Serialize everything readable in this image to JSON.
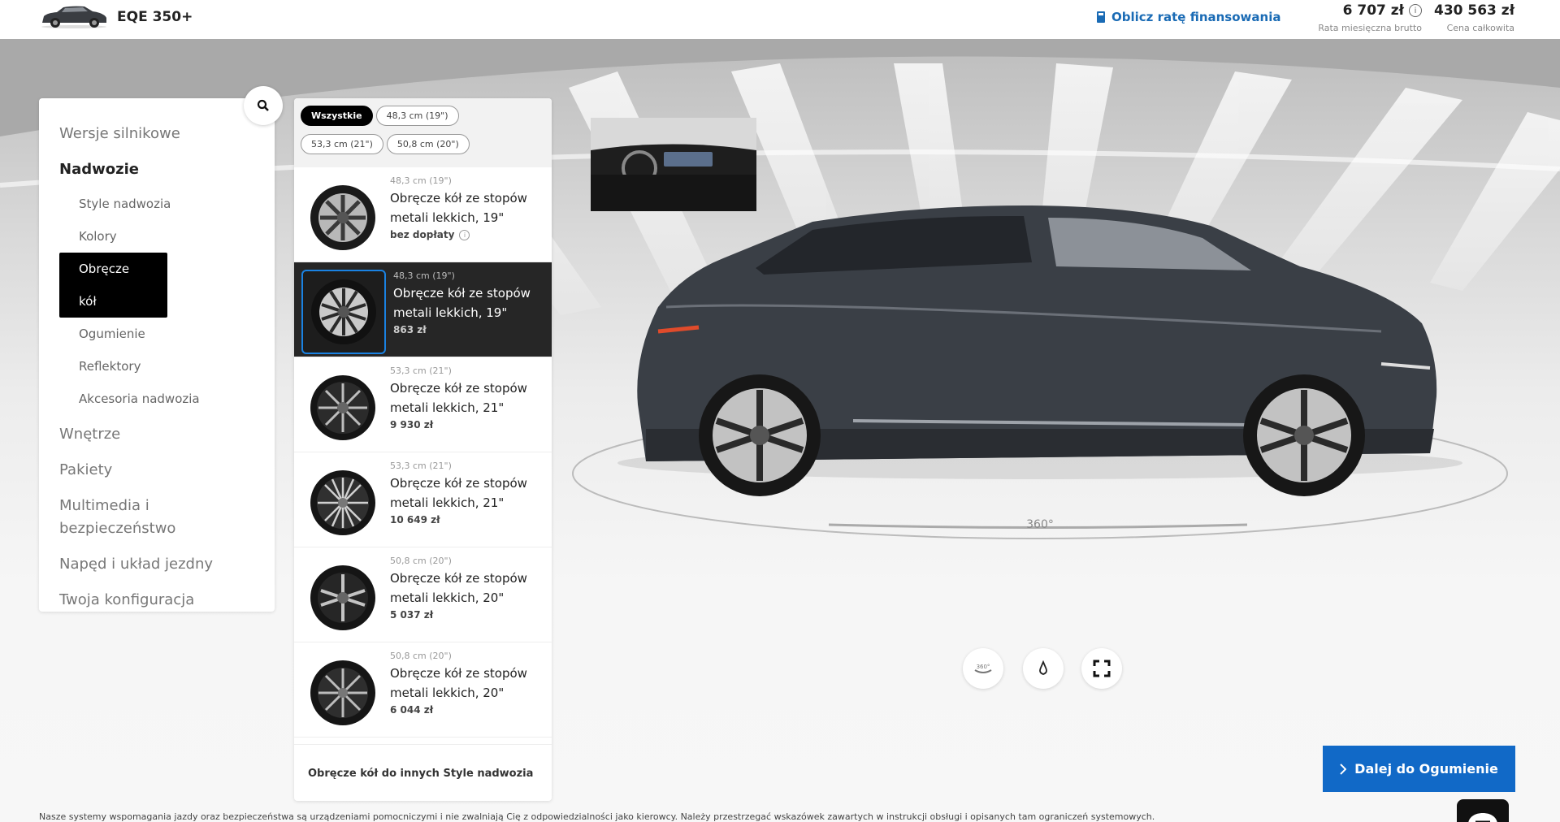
{
  "header": {
    "model": "EQE 350+",
    "finance_link": "Oblicz ratę finansowania",
    "monthly_price": "6 707 zł",
    "monthly_label": "Rata miesięczna brutto",
    "total_price": "430 563 zł",
    "total_label": "Cena całkowita",
    "info_icon": "info-icon",
    "calculator_icon": "calculator-icon"
  },
  "nav": {
    "items": [
      {
        "label": "Wersje silnikowe"
      },
      {
        "label": "Nadwozie"
      },
      {
        "label": "Wnętrze"
      },
      {
        "label": "Pakiety"
      },
      {
        "label": "Multimedia i bezpieczeństwo"
      },
      {
        "label": "Napęd i układ jezdny"
      },
      {
        "label": "Twoja konfiguracja"
      }
    ],
    "sub_items": [
      {
        "label": "Style nadwozia"
      },
      {
        "label": "Kolory"
      },
      {
        "label": "Obręcze kół"
      },
      {
        "label": "Ogumienie"
      },
      {
        "label": "Reflektory"
      },
      {
        "label": "Akcesoria nadwozia"
      }
    ],
    "search_icon": "search-icon"
  },
  "filters": {
    "chips": [
      {
        "label": "Wszystkie"
      },
      {
        "label": "48,3 cm (19\")"
      },
      {
        "label": "53,3 cm (21\")"
      },
      {
        "label": "50,8 cm (20\")"
      }
    ]
  },
  "wheels": [
    {
      "size": "48,3 cm (19\")",
      "name": "Obręcze kół ze stopów metali lekkich, 19\"",
      "price": "bez dopłaty"
    },
    {
      "size": "48,3 cm (19\")",
      "name": "Obręcze kół ze stopów metali lekkich, 19\"",
      "price": "863 zł"
    },
    {
      "size": "53,3 cm (21\")",
      "name": "Obręcze kół ze stopów metali lekkich, 21\"",
      "price": "9 930 zł"
    },
    {
      "size": "53,3 cm (21\")",
      "name": "Obręcze kół ze stopów metali lekkich, 21\"",
      "price": "10 649 zł"
    },
    {
      "size": "50,8 cm (20\")",
      "name": "Obręcze kół ze stopów metali lekkich, 20\"",
      "price": "5 037 zł"
    },
    {
      "size": "50,8 cm (20\")",
      "name": "Obręcze kół ze stopów metali lekkich, 20\"",
      "price": "6 044 zł"
    }
  ],
  "other_styles": "Obręcze kół do innych Style nadwozia",
  "viewer": {
    "rotate_label": "360°",
    "controls": [
      "rotate-360-icon",
      "light-icon",
      "fullscreen-icon"
    ]
  },
  "next_button": "Dalej do Ogumienie",
  "disclaimer": "Nasze systemy wspomagania jazdy oraz bezpieczeństwa są urządzeniami pomocniczymi i nie zwalniają Cię z odpowiedzialności jako kierowcy. Należy przestrzegać wskazówek zawartych w instrukcji obsługi i opisanych tam ograniczeń systemowych.",
  "colors": {
    "accent": "#1169c7",
    "link": "#1a6bb5",
    "selected_bg": "#262626",
    "selected_border": "#1a82e2"
  }
}
